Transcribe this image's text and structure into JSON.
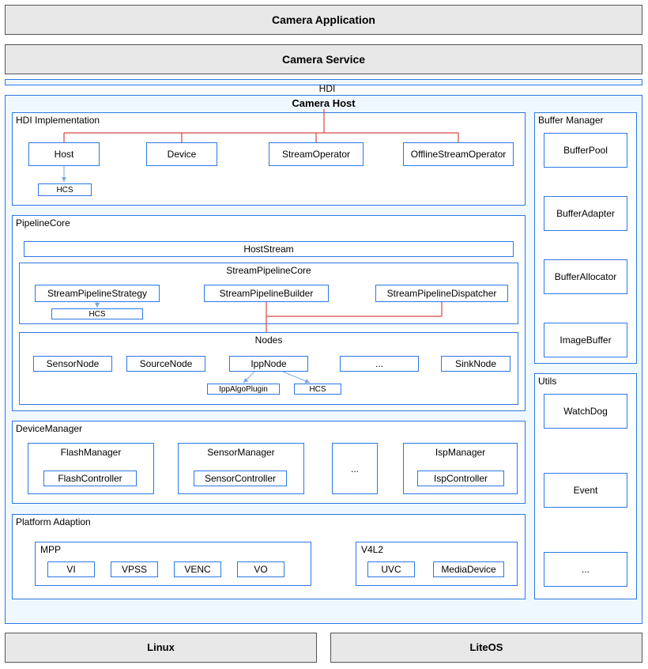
{
  "top": {
    "app": "Camera Application",
    "service": "Camera Service"
  },
  "hdi": "HDI",
  "cameraHost": "Camera Host",
  "hdiImpl": {
    "title": "HDI Implementation",
    "host": "Host",
    "device": "Device",
    "streamOp": "StreamOperator",
    "offlineOp": "OfflineStreamOperator",
    "hcs": "HCS"
  },
  "pipelineCore": {
    "title": "PipelineCore",
    "hostStream": "HostStream",
    "spc": {
      "title": "StreamPipelineCore",
      "strategy": "StreamPipelineStrategy",
      "builder": "StreamPipelineBuilder",
      "dispatcher": "StreamPipelineDispatcher",
      "hcs": "HCS"
    },
    "nodes": {
      "title": "Nodes",
      "sensor": "SensorNode",
      "source": "SourceNode",
      "ipp": "IppNode",
      "dots": "...",
      "sink": "SinkNode",
      "ippPlugin": "IppAlgoPlugin",
      "hcs": "HCS"
    }
  },
  "deviceManager": {
    "title": "DeviceManager",
    "flash": {
      "mgr": "FlashManager",
      "ctrl": "FlashController"
    },
    "sensor": {
      "mgr": "SensorManager",
      "ctrl": "SensorController"
    },
    "dots": "...",
    "isp": {
      "mgr": "IspManager",
      "ctrl": "IspController"
    }
  },
  "platform": {
    "title": "Platform Adaption",
    "mpp": {
      "title": "MPP",
      "vi": "VI",
      "vpss": "VPSS",
      "venc": "VENC",
      "vo": "VO"
    },
    "v4l2": {
      "title": "V4L2",
      "uvc": "UVC",
      "media": "MediaDevice"
    }
  },
  "bufferManager": {
    "title": "Buffer Manager",
    "pool": "BufferPool",
    "adapter": "BufferAdapter",
    "allocator": "BufferAllocator",
    "imageBuffer": "ImageBuffer"
  },
  "utils": {
    "title": "Utils",
    "watchdog": "WatchDog",
    "event": "Event",
    "dots": "..."
  },
  "os": {
    "linux": "Linux",
    "liteos": "LiteOS"
  }
}
